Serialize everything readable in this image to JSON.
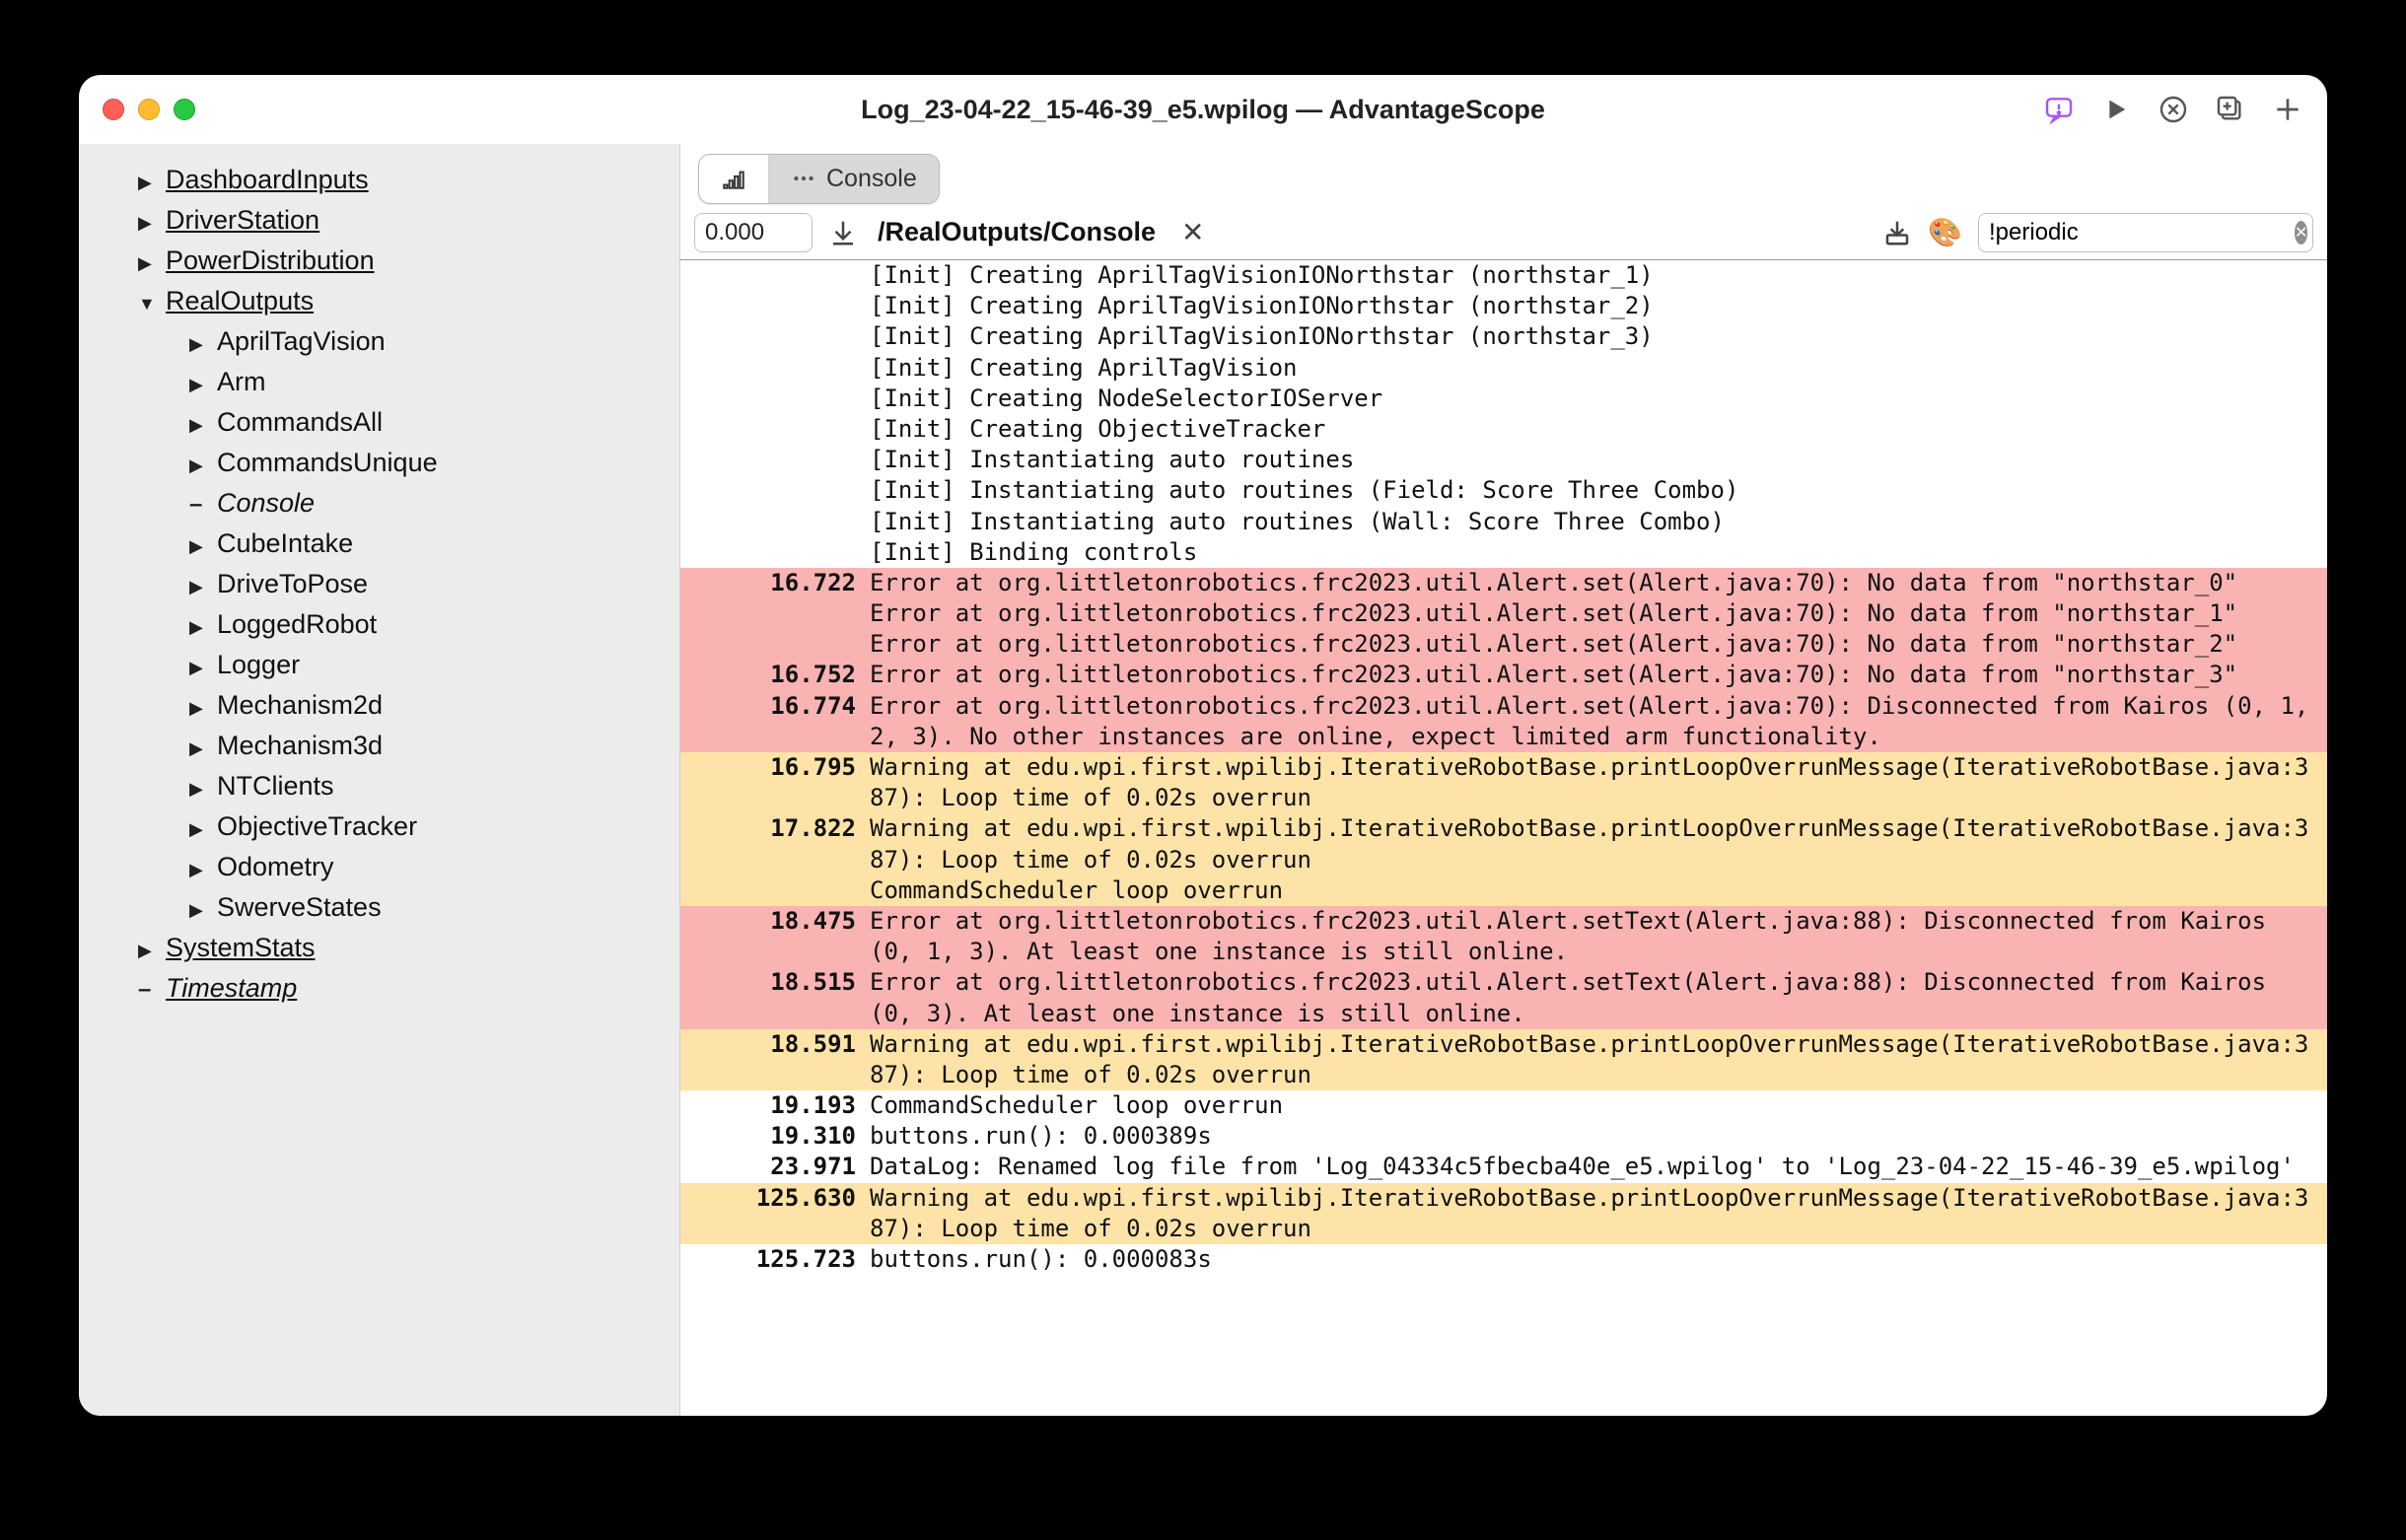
{
  "window_title": "Log_23-04-22_15-46-39_e5.wpilog — AdvantageScope",
  "sidebar": {
    "items": [
      {
        "label": "DashboardInputs",
        "level": 0,
        "arrow": "right",
        "underline": true
      },
      {
        "label": "DriverStation",
        "level": 0,
        "arrow": "right",
        "underline": true
      },
      {
        "label": "PowerDistribution",
        "level": 0,
        "arrow": "right",
        "underline": true
      },
      {
        "label": "RealOutputs",
        "level": 0,
        "arrow": "down",
        "underline": true
      },
      {
        "label": "AprilTagVision",
        "level": 1,
        "arrow": "right"
      },
      {
        "label": "Arm",
        "level": 1,
        "arrow": "right"
      },
      {
        "label": "CommandsAll",
        "level": 1,
        "arrow": "right"
      },
      {
        "label": "CommandsUnique",
        "level": 1,
        "arrow": "right"
      },
      {
        "label": "Console",
        "level": 1,
        "arrow": "dash",
        "italic": true
      },
      {
        "label": "CubeIntake",
        "level": 1,
        "arrow": "right"
      },
      {
        "label": "DriveToPose",
        "level": 1,
        "arrow": "right"
      },
      {
        "label": "LoggedRobot",
        "level": 1,
        "arrow": "right"
      },
      {
        "label": "Logger",
        "level": 1,
        "arrow": "right"
      },
      {
        "label": "Mechanism2d",
        "level": 1,
        "arrow": "right"
      },
      {
        "label": "Mechanism3d",
        "level": 1,
        "arrow": "right"
      },
      {
        "label": "NTClients",
        "level": 1,
        "arrow": "right"
      },
      {
        "label": "ObjectiveTracker",
        "level": 1,
        "arrow": "right"
      },
      {
        "label": "Odometry",
        "level": 1,
        "arrow": "right"
      },
      {
        "label": "SwerveStates",
        "level": 1,
        "arrow": "right"
      },
      {
        "label": "SystemStats",
        "level": 0,
        "arrow": "right",
        "underline": true
      },
      {
        "label": "Timestamp",
        "level": 0,
        "arrow": "dash",
        "underline": true,
        "italic": true
      }
    ]
  },
  "tabs": {
    "console_label": "Console"
  },
  "controlbar": {
    "time": "0.000",
    "path": "/RealOutputs/Console",
    "palette_emoji": "🎨",
    "search": "!periodic"
  },
  "console_rows": [
    {
      "ts": "",
      "level": "",
      "msg": "[Init] Creating AprilTagVisionIONorthstar (northstar_1)"
    },
    {
      "ts": "",
      "level": "",
      "msg": "[Init] Creating AprilTagVisionIONorthstar (northstar_2)"
    },
    {
      "ts": "",
      "level": "",
      "msg": "[Init] Creating AprilTagVisionIONorthstar (northstar_3)"
    },
    {
      "ts": "",
      "level": "",
      "msg": "[Init] Creating AprilTagVision"
    },
    {
      "ts": "",
      "level": "",
      "msg": "[Init] Creating NodeSelectorIOServer"
    },
    {
      "ts": "",
      "level": "",
      "msg": "[Init] Creating ObjectiveTracker"
    },
    {
      "ts": "",
      "level": "",
      "msg": "[Init] Instantiating auto routines"
    },
    {
      "ts": "",
      "level": "",
      "msg": "[Init] Instantiating auto routines (Field: Score Three Combo)"
    },
    {
      "ts": "",
      "level": "",
      "msg": "[Init] Instantiating auto routines (Wall: Score Three Combo)"
    },
    {
      "ts": "",
      "level": "",
      "msg": "[Init] Binding controls"
    },
    {
      "ts": "16.722",
      "level": "err",
      "msg": "Error at org.littletonrobotics.frc2023.util.Alert.set(Alert.java:70): No data from \"northstar_0\""
    },
    {
      "ts": "",
      "level": "err",
      "msg": "Error at org.littletonrobotics.frc2023.util.Alert.set(Alert.java:70): No data from \"northstar_1\""
    },
    {
      "ts": "",
      "level": "err",
      "msg": "Error at org.littletonrobotics.frc2023.util.Alert.set(Alert.java:70): No data from \"northstar_2\""
    },
    {
      "ts": "16.752",
      "level": "err",
      "msg": "Error at org.littletonrobotics.frc2023.util.Alert.set(Alert.java:70): No data from \"northstar_3\""
    },
    {
      "ts": "16.774",
      "level": "err",
      "msg": "Error at org.littletonrobotics.frc2023.util.Alert.set(Alert.java:70): Disconnected from Kairos (0, 1, 2, 3). No other instances are online, expect limited arm functionality."
    },
    {
      "ts": "16.795",
      "level": "warn",
      "msg": "Warning at edu.wpi.first.wpilibj.IterativeRobotBase.printLoopOverrunMessage(IterativeRobotBase.java:387): Loop time of 0.02s overrun"
    },
    {
      "ts": "17.822",
      "level": "warn",
      "msg": "Warning at edu.wpi.first.wpilibj.IterativeRobotBase.printLoopOverrunMessage(IterativeRobotBase.java:387): Loop time of 0.02s overrun"
    },
    {
      "ts": "",
      "level": "warn",
      "msg": ""
    },
    {
      "ts": "",
      "level": "warn",
      "msg": "CommandScheduler loop overrun"
    },
    {
      "ts": "18.475",
      "level": "err",
      "msg": "Error at org.littletonrobotics.frc2023.util.Alert.setText(Alert.java:88): Disconnected from Kairos (0, 1, 3). At least one instance is still online."
    },
    {
      "ts": "18.515",
      "level": "err",
      "msg": "Error at org.littletonrobotics.frc2023.util.Alert.setText(Alert.java:88): Disconnected from Kairos (0, 3). At least one instance is still online."
    },
    {
      "ts": "18.591",
      "level": "warn",
      "msg": "Warning at edu.wpi.first.wpilibj.IterativeRobotBase.printLoopOverrunMessage(IterativeRobotBase.java:387): Loop time of 0.02s overrun"
    },
    {
      "ts": "19.193",
      "level": "",
      "msg": "CommandScheduler loop overrun"
    },
    {
      "ts": "19.310",
      "level": "",
      "msg": "buttons.run(): 0.000389s"
    },
    {
      "ts": "23.971",
      "level": "",
      "msg": "DataLog: Renamed log file from 'Log_04334c5fbecba40e_e5.wpilog' to 'Log_23-04-22_15-46-39_e5.wpilog'"
    },
    {
      "ts": "125.630",
      "level": "warn",
      "msg": "Warning at edu.wpi.first.wpilibj.IterativeRobotBase.printLoopOverrunMessage(IterativeRobotBase.java:387): Loop time of 0.02s overrun"
    },
    {
      "ts": "125.723",
      "level": "",
      "msg": "buttons.run(): 0.000083s"
    }
  ]
}
